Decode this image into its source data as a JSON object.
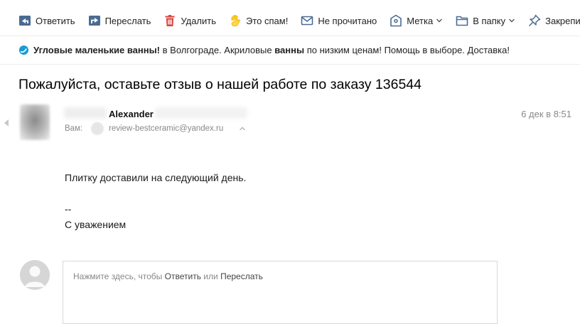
{
  "toolbar": {
    "items": [
      {
        "label": "Ответить",
        "icon": "reply-icon"
      },
      {
        "label": "Переслать",
        "icon": "forward-icon"
      },
      {
        "label": "Удалить",
        "icon": "trash-icon"
      },
      {
        "label": "Это спам!",
        "icon": "spam-hand-icon"
      },
      {
        "label": "Не прочитано",
        "icon": "envelope-icon"
      },
      {
        "label": "Метка",
        "icon": "label-tag-icon"
      },
      {
        "label": "В папку",
        "icon": "folder-icon"
      },
      {
        "label": "Закрепить",
        "icon": "pin-icon"
      }
    ]
  },
  "ad": {
    "bold1": "Угловые маленькие ванны!",
    "text1": "в Волгограде. Акриловые",
    "bold2": "ванны",
    "text2": "по низким ценам! Помощь в выборе. Доставка!"
  },
  "message": {
    "subject": "Пожалуйста, оставьте отзыв о нашей работе по заказу 136544",
    "sender_name": "Alexander",
    "date": "6 дек в 8:51",
    "to_label": "Вам:",
    "to_email": "review-bestceramic@yandex.ru",
    "body": {
      "line1": "Плитку доставили на следующий день.",
      "sig_dash": "--",
      "sig": "С уважением"
    }
  },
  "reply": {
    "prefix": "Нажмите здесь, чтобы",
    "reply_link": "Ответить",
    "or": "или",
    "forward_link": "Переслать"
  },
  "colors": {
    "icon_blue": "#4a6b92",
    "icon_red": "#d9453c",
    "icon_yellow": "#f5b800",
    "ad_logo": "#1a9bd7",
    "muted_text": "#888888"
  }
}
